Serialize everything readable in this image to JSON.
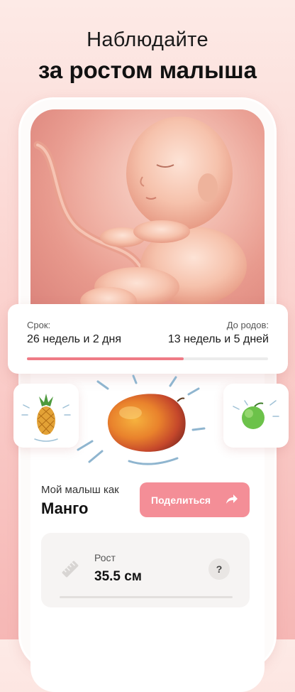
{
  "headline": {
    "line1": "Наблюдайте",
    "line2": "за ростом малыша"
  },
  "term": {
    "current_label": "Срок:",
    "current_value": "26 недель и 2 дня",
    "remaining_label": "До родов:",
    "remaining_value": "13 недель и 5 дней",
    "progress_fraction": 0.65
  },
  "comparison": {
    "prefix": "Мой малыш как",
    "fruit": "Манго",
    "share_label": "Поделиться",
    "current_fruit_icon": "mango-icon",
    "previous_fruit_icon": "pineapple-icon",
    "next_fruit_icon": "lime-icon"
  },
  "stats": {
    "growth_label": "Рост",
    "growth_value": "35.5 см",
    "help_label": "?"
  },
  "colors": {
    "accent": "#f48e97",
    "progress": "#ef7b86",
    "background_top": "#fdeae6",
    "background_bottom": "#f6b7b5"
  }
}
